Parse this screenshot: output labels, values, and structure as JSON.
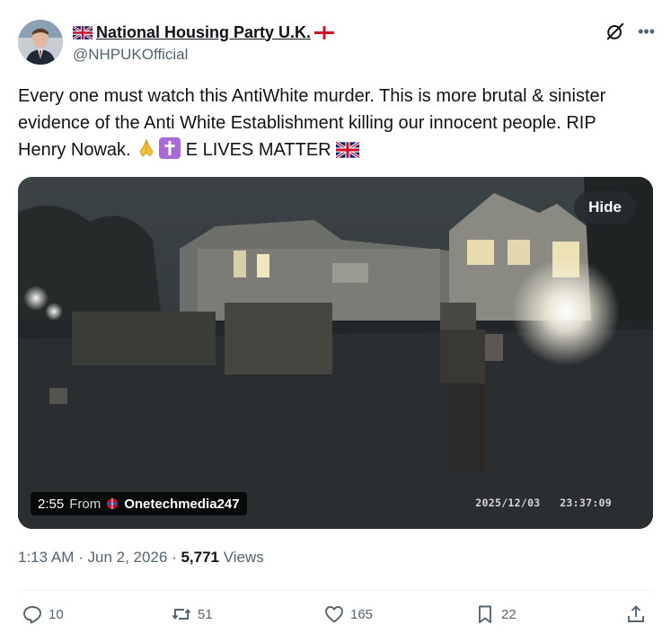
{
  "author": {
    "display_name": "National Housing Party U.K.",
    "handle": "@NHPUKOfficial"
  },
  "tweet": {
    "text_main": "Every one must watch this AntiWhite murder.  This is more brutal & sinister evidence of the Anti White Establishment killing our innocent people.  RIP Henry Nowak. ",
    "text_tail": " E LIVES MATTER "
  },
  "media": {
    "hide_label": "Hide",
    "duration": "2:55",
    "from_label": "From",
    "source_name": "Onetechmedia247",
    "timestamp_overlay": "2025/12/03   23:37:09"
  },
  "meta": {
    "time": "1:13 AM",
    "sep1": " · ",
    "date": "Jun 2, 2026",
    "sep2": " · ",
    "views_count": "5,771",
    "views_label": " Views"
  },
  "actions": {
    "replies": "10",
    "reposts": "51",
    "likes": "165",
    "bookmarks": "22"
  },
  "icons": {
    "flag_left": "uk-flag-icon",
    "flag_right": "england-flag-icon",
    "grok": "grok-icon",
    "more": "more-icon",
    "emoji1": "folded-hands-icon",
    "emoji2": "latin-cross-icon",
    "emoji3": "uk-flag-icon"
  },
  "colors": {
    "text": "#0f1419",
    "secondary": "#536471",
    "emoji_cross_bg": "#a86bd6"
  }
}
